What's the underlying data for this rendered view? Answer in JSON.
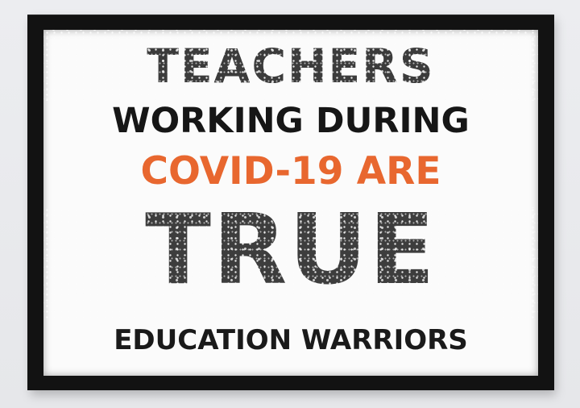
{
  "poster": {
    "line1": "TEACHERS",
    "line2": "WORKING DURING",
    "line3": "COVID-19 ARE",
    "line4": "TRUE",
    "line5": "EDUCATION WARRIORS"
  },
  "colors": {
    "dark_text": "#3b3b3b",
    "black_text": "#161616",
    "accent_orange": "#e8672f",
    "frame": "#121212",
    "mat": "#fbfbfb",
    "wall": "#e9eaed"
  }
}
